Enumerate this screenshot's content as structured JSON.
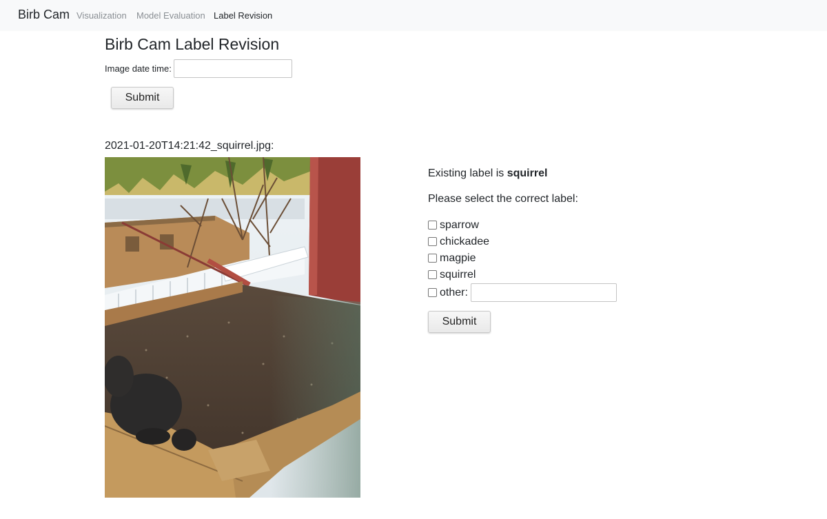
{
  "nav": {
    "brand": "Birb Cam",
    "links": [
      "Visualization",
      "Model Evaluation",
      "Label Revision"
    ],
    "active": "Label Revision"
  },
  "page": {
    "title": "Birb Cam Label Revision"
  },
  "date_form": {
    "label": "Image date time:",
    "value": "",
    "submit_label": "Submit"
  },
  "image": {
    "filename": "2021-01-20T14:21:42_squirrel.jpg:"
  },
  "label_form": {
    "existing_prefix": "Existing label is ",
    "existing_label": "squirrel",
    "prompt": "Please select the correct label:",
    "options": [
      "sparrow",
      "chickadee",
      "magpie",
      "squirrel",
      "other:"
    ],
    "other_value": "",
    "submit_label": "Submit"
  }
}
